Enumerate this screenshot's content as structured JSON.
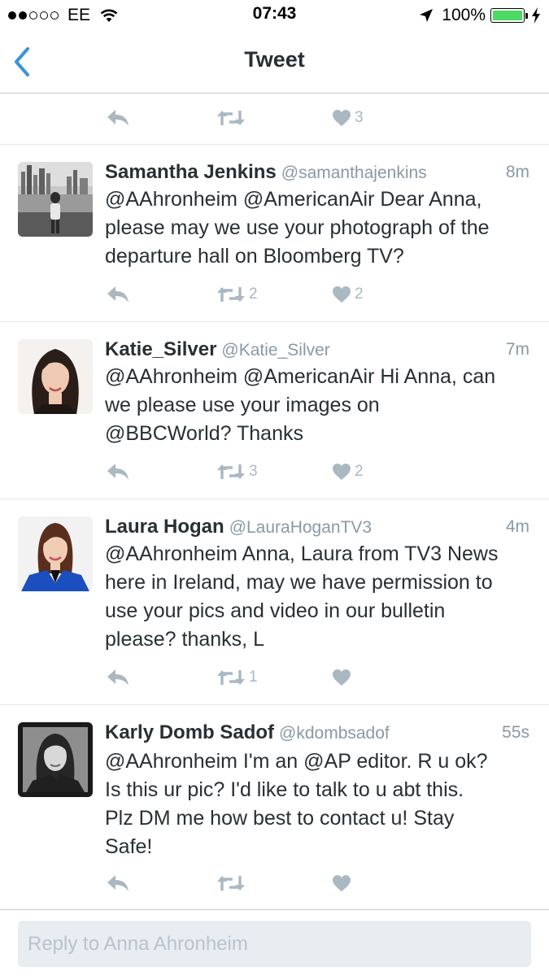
{
  "status_bar": {
    "signal_dots_filled": 2,
    "signal_dots_total": 5,
    "carrier": "EE",
    "time": "07:43",
    "battery_percent": "100%",
    "battery_color": "#4cd964"
  },
  "nav": {
    "title": "Tweet",
    "back_icon": "chevron-left-icon",
    "accent_color": "#3b94d9"
  },
  "top_actions": {
    "reply_count": "",
    "retweet_count": "",
    "like_count": "3"
  },
  "tweets": [
    {
      "name": "Samantha Jenkins",
      "handle": "@samanthajenkins",
      "time": "8m",
      "text": "@AAhronheim @AmericanAir Dear Anna,\nplease may we use your photograph of the\ndeparture hall on Bloomberg TV?",
      "reply_count": "",
      "retweet_count": "2",
      "like_count": "2"
    },
    {
      "name": "Katie_Silver",
      "handle": "@Katie_Silver",
      "time": "7m",
      "text": "@AAhronheim @AmericanAir Hi Anna, can\nwe please use your images on\n@BBCWorld? Thanks",
      "reply_count": "",
      "retweet_count": "3",
      "like_count": "2"
    },
    {
      "name": "Laura Hogan",
      "handle": "@LauraHoganTV3",
      "time": "4m",
      "text": "@AAhronheim Anna, Laura from TV3 News\nhere in Ireland, may we have permission to\nuse your pics and video in our bulletin\nplease? thanks, L",
      "reply_count": "",
      "retweet_count": "1",
      "like_count": ""
    },
    {
      "name": "Karly Domb Sadof",
      "handle": "@kdombsadof",
      "time": "55s",
      "text": "@AAhronheim I'm an @AP editor. R u ok?\nIs this ur pic? I'd like to talk to u abt this.\nPlz DM me how best to contact u! Stay\nSafe!",
      "reply_count": "",
      "retweet_count": "",
      "like_count": ""
    }
  ],
  "reply_bar": {
    "placeholder": "Reply to Anna Ahronheim",
    "value": ""
  }
}
